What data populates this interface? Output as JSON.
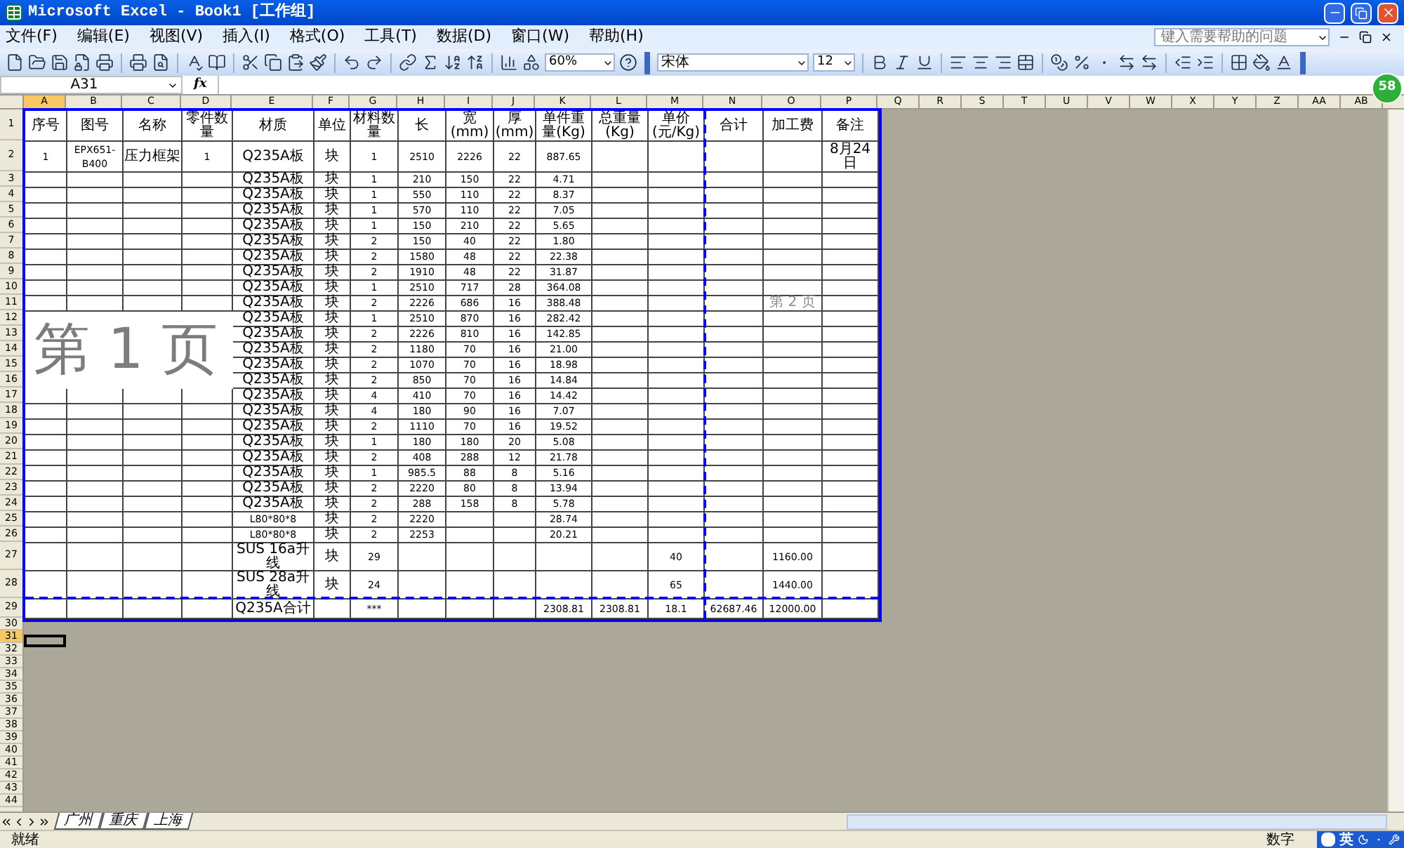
{
  "window": {
    "title": "Microsoft Excel - Book1 [工作组]"
  },
  "menu": [
    "文件(F)",
    "编辑(E)",
    "视图(V)",
    "插入(I)",
    "格式(O)",
    "工具(T)",
    "数据(D)",
    "窗口(W)",
    "帮助(H)"
  ],
  "help_box": {
    "placeholder": "键入需要帮助的问题"
  },
  "toolbar": {
    "zoom": "60%",
    "font": "宋体",
    "font_size": "12"
  },
  "formula_bar": {
    "name_box": "A31",
    "function_label": "fx"
  },
  "badge": "58",
  "columns": [
    {
      "label": "A",
      "selected": true
    },
    {
      "label": "B",
      "selected": false
    },
    {
      "label": "C",
      "selected": false
    },
    {
      "label": "D",
      "selected": false
    },
    {
      "label": "E",
      "selected": false
    },
    {
      "label": "F",
      "selected": false
    },
    {
      "label": "G",
      "selected": false
    },
    {
      "label": "H",
      "selected": false
    },
    {
      "label": "I",
      "selected": false
    },
    {
      "label": "J",
      "selected": false
    },
    {
      "label": "K",
      "selected": false
    },
    {
      "label": "L",
      "selected": false
    },
    {
      "label": "M",
      "selected": false
    },
    {
      "label": "N",
      "selected": false
    },
    {
      "label": "O",
      "selected": false
    },
    {
      "label": "P",
      "selected": false
    },
    {
      "label": "Q",
      "selected": false
    },
    {
      "label": "R",
      "selected": false
    },
    {
      "label": "S",
      "selected": false
    },
    {
      "label": "T",
      "selected": false
    },
    {
      "label": "U",
      "selected": false
    },
    {
      "label": "V",
      "selected": false
    },
    {
      "label": "W",
      "selected": false
    },
    {
      "label": "X",
      "selected": false
    },
    {
      "label": "Y",
      "selected": false
    },
    {
      "label": "Z",
      "selected": false
    },
    {
      "label": "AA",
      "selected": false
    },
    {
      "label": "AB",
      "selected": false
    }
  ],
  "table": {
    "rows": [
      {
        "number": "1",
        "cells": {
          "A": "序号",
          "B": "图号",
          "C": "名称",
          "D": "零件数量",
          "E": "材质",
          "F": "单位",
          "G": "材料数量",
          "H": "长",
          "I": "宽 (mm)",
          "J": "厚 (mm)",
          "K": "单件重量(Kg)",
          "L": "总重量(Kg)",
          "M": "单价(元/Kg)",
          "N": "合计",
          "O": "加工费",
          "P": "备注"
        }
      },
      {
        "number": "2",
        "cells": {
          "A": "1",
          "B": "EPX651-B400",
          "C": "压力框架",
          "D": "1",
          "E": "Q235A板",
          "F": "块",
          "G": "1",
          "H": "2510",
          "I": "2226",
          "J": "22",
          "K": "887.65",
          "P": "8月24日"
        }
      },
      {
        "number": "3",
        "cells": {
          "E": "Q235A板",
          "F": "块",
          "G": "1",
          "H": "210",
          "I": "150",
          "J": "22",
          "K": "4.71"
        }
      },
      {
        "number": "4",
        "cells": {
          "E": "Q235A板",
          "F": "块",
          "G": "1",
          "H": "550",
          "I": "110",
          "J": "22",
          "K": "8.37"
        }
      },
      {
        "number": "5",
        "cells": {
          "E": "Q235A板",
          "F": "块",
          "G": "1",
          "H": "570",
          "I": "110",
          "J": "22",
          "K": "7.05"
        }
      },
      {
        "number": "6",
        "cells": {
          "E": "Q235A板",
          "F": "块",
          "G": "1",
          "H": "150",
          "I": "210",
          "J": "22",
          "K": "5.65"
        }
      },
      {
        "number": "7",
        "cells": {
          "E": "Q235A板",
          "F": "块",
          "G": "2",
          "H": "150",
          "I": "40",
          "J": "22",
          "K": "1.80"
        }
      },
      {
        "number": "8",
        "cells": {
          "E": "Q235A板",
          "F": "块",
          "G": "2",
          "H": "1580",
          "I": "48",
          "J": "22",
          "K": "22.38"
        }
      },
      {
        "number": "9",
        "cells": {
          "E": "Q235A板",
          "F": "块",
          "G": "2",
          "H": "1910",
          "I": "48",
          "J": "22",
          "K": "31.87"
        }
      },
      {
        "number": "10",
        "cells": {
          "E": "Q235A板",
          "F": "块",
          "G": "1",
          "H": "2510",
          "I": "717",
          "J": "28",
          "K": "364.08"
        }
      },
      {
        "number": "11",
        "cells": {
          "E": "Q235A板",
          "F": "块",
          "G": "2",
          "H": "2226",
          "I": "686",
          "J": "16",
          "K": "388.48"
        }
      },
      {
        "number": "12",
        "cells": {
          "E": "Q235A板",
          "F": "块",
          "G": "1",
          "H": "2510",
          "I": "870",
          "J": "16",
          "K": "282.42"
        }
      },
      {
        "number": "13",
        "cells": {
          "E": "Q235A板",
          "F": "块",
          "G": "2",
          "H": "2226",
          "I": "810",
          "J": "16",
          "K": "142.85"
        }
      },
      {
        "number": "14",
        "cells": {
          "E": "Q235A板",
          "F": "块",
          "G": "2",
          "H": "1180",
          "I": "70",
          "J": "16",
          "K": "21.00"
        }
      },
      {
        "number": "15",
        "cells": {
          "E": "Q235A板",
          "F": "块",
          "G": "2",
          "H": "1070",
          "I": "70",
          "J": "16",
          "K": "18.98"
        }
      },
      {
        "number": "16",
        "cells": {
          "E": "Q235A板",
          "F": "块",
          "G": "2",
          "H": "850",
          "I": "70",
          "J": "16",
          "K": "14.84"
        }
      },
      {
        "number": "17",
        "cells": {
          "E": "Q235A板",
          "F": "块",
          "G": "4",
          "H": "410",
          "I": "70",
          "J": "16",
          "K": "14.42"
        }
      },
      {
        "number": "18",
        "cells": {
          "E": "Q235A板",
          "F": "块",
          "G": "4",
          "H": "180",
          "I": "90",
          "J": "16",
          "K": "7.07"
        }
      },
      {
        "number": "19",
        "cells": {
          "E": "Q235A板",
          "F": "块",
          "G": "2",
          "H": "1110",
          "I": "70",
          "J": "16",
          "K": "19.52"
        }
      },
      {
        "number": "20",
        "cells": {
          "E": "Q235A板",
          "F": "块",
          "G": "1",
          "H": "180",
          "I": "180",
          "J": "20",
          "K": "5.08"
        }
      },
      {
        "number": "21",
        "cells": {
          "E": "Q235A板",
          "F": "块",
          "G": "2",
          "H": "408",
          "I": "288",
          "J": "12",
          "K": "21.78"
        }
      },
      {
        "number": "22",
        "cells": {
          "E": "Q235A板",
          "F": "块",
          "G": "1",
          "H": "985.5",
          "I": "88",
          "J": "8",
          "K": "5.16"
        }
      },
      {
        "number": "23",
        "cells": {
          "E": "Q235A板",
          "F": "块",
          "G": "2",
          "H": "2220",
          "I": "80",
          "J": "8",
          "K": "13.94"
        }
      },
      {
        "number": "24",
        "cells": {
          "E": "Q235A板",
          "F": "块",
          "G": "2",
          "H": "288",
          "I": "158",
          "J": "8",
          "K": "5.78"
        }
      },
      {
        "number": "25",
        "cells": {
          "E": "L80*80*8",
          "F": "块",
          "G": "2",
          "H": "2220",
          "K": "28.74"
        }
      },
      {
        "number": "26",
        "cells": {
          "E": "L80*80*8",
          "F": "块",
          "G": "2",
          "H": "2253",
          "K": "20.21"
        }
      },
      {
        "number": "27",
        "cells": {
          "E": "SUS 16a升线",
          "F": "块",
          "G": "29",
          "M": "40",
          "O": "1160.00"
        }
      },
      {
        "number": "28",
        "cells": {
          "E": "SUS 28a升线",
          "F": "块",
          "G": "24",
          "M": "65",
          "O": "1440.00"
        }
      },
      {
        "number": "29",
        "cells": {
          "E": "Q235A合计",
          "G": "***",
          "K": "2308.81",
          "L": "2308.81",
          "M": "18.1",
          "N": "62687.46",
          "O": "12000.00"
        }
      }
    ]
  },
  "page_labels": [
    "第 1 页",
    "第 2 页"
  ],
  "blank_rows": [
    {
      "number": "30",
      "selected": false
    },
    {
      "number": "31",
      "selected": true
    },
    {
      "number": "32",
      "selected": false
    },
    {
      "number": "33",
      "selected": false
    },
    {
      "number": "34",
      "selected": false
    },
    {
      "number": "35",
      "selected": false
    },
    {
      "number": "36",
      "selected": false
    },
    {
      "number": "37",
      "selected": false
    },
    {
      "number": "38",
      "selected": false
    },
    {
      "number": "39",
      "selected": false
    },
    {
      "number": "40",
      "selected": false
    },
    {
      "number": "41",
      "selected": false
    },
    {
      "number": "42",
      "selected": false
    },
    {
      "number": "43",
      "selected": false
    },
    {
      "number": "44",
      "selected": false
    }
  ],
  "sheet_tabs": [
    {
      "label": "广州",
      "selected": true
    },
    {
      "label": "重庆",
      "selected": true
    },
    {
      "label": "上海",
      "selected": true
    }
  ],
  "status_bar": {
    "left": "就绪",
    "mode": "数字",
    "ime": "英"
  }
}
